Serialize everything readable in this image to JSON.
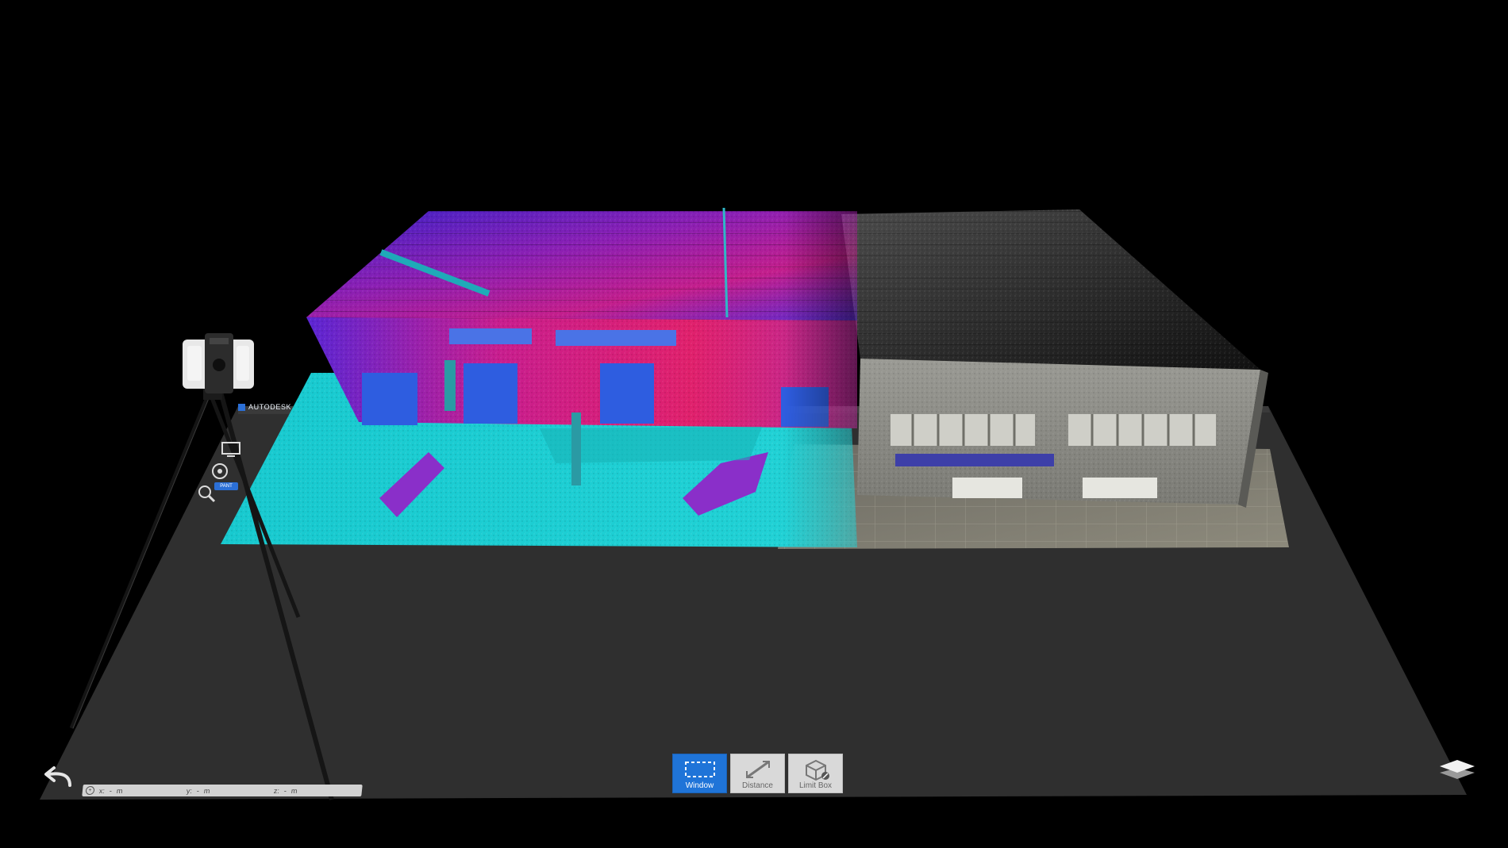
{
  "app": {
    "header_label": "AUTODESK",
    "badge_label": "PANT"
  },
  "toolbar": {
    "buttons": [
      {
        "id": "window",
        "label": "Window",
        "icon": "selection-window-icon",
        "active": true
      },
      {
        "id": "distance",
        "label": "Distance",
        "icon": "measure-distance-icon",
        "active": false
      },
      {
        "id": "limit_box",
        "label": "Limit Box",
        "icon": "limit-box-icon",
        "active": false
      }
    ]
  },
  "coordinates": {
    "x_label": "x:",
    "x_value": "-",
    "x_unit": "m",
    "y_label": "y:",
    "y_value": "-",
    "y_unit": "m",
    "z_label": "z:",
    "z_value": "-",
    "z_unit": "m"
  },
  "left_tools": [
    {
      "name": "display-icon"
    },
    {
      "name": "orbit-icon"
    },
    {
      "name": "zoom-icon"
    }
  ],
  "icons": {
    "back": "undo-arrow-icon",
    "layers": "layers-icon",
    "scanner": "laser-scanner-icon"
  },
  "colors": {
    "background": "#000000",
    "floor": "#2f2f2f",
    "accent": "#1f74d8",
    "toolbar_button": "#d9d9d9",
    "intensity_cyan": "#1fd6d6",
    "intensity_purple": "#6a2bd8",
    "intensity_magenta": "#d8209a",
    "rgb_gray": "#8a8a8a"
  }
}
